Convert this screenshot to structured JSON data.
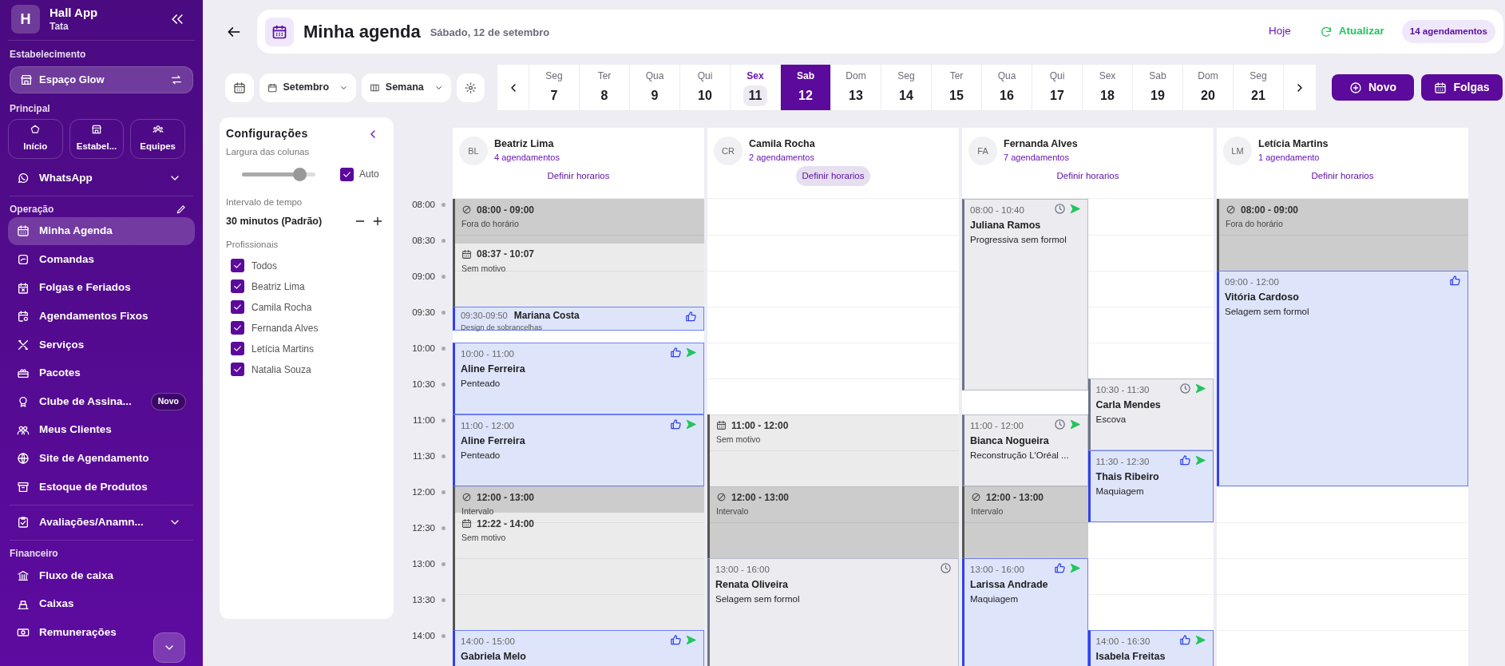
{
  "sidebar": {
    "logo_letter": "H",
    "app_name": "Hall App",
    "user": "Tata",
    "establishment_label": "Estabelecimento",
    "establishment": "Espaço Glow",
    "principal_label": "Principal",
    "tiles": [
      {
        "label": "Início"
      },
      {
        "label": "Estabel..."
      },
      {
        "label": "Equipes"
      }
    ],
    "groups": [
      {
        "items": [
          {
            "label": "WhatsApp",
            "kind": "expandable",
            "selected": false
          }
        ]
      },
      {
        "title": "Operação",
        "editable": true,
        "items": [
          {
            "label": "Minha Agenda",
            "kind": "link",
            "selected": true
          },
          {
            "label": "Comandas",
            "kind": "link",
            "selected": false
          },
          {
            "label": "Folgas e Feriados",
            "kind": "link",
            "selected": false
          },
          {
            "label": "Agendamentos Fixos",
            "kind": "link",
            "selected": false
          },
          {
            "label": "Serviços",
            "kind": "link",
            "selected": false
          },
          {
            "label": "Pacotes",
            "kind": "link",
            "selected": false
          },
          {
            "label": "Clube de Assina...",
            "kind": "link",
            "selected": false,
            "badge": "Novo"
          },
          {
            "label": "Meus Clientes",
            "kind": "link",
            "selected": false
          },
          {
            "label": "Site de Agendamento",
            "kind": "link",
            "selected": false
          },
          {
            "label": "Estoque de Produtos",
            "kind": "link",
            "selected": false
          }
        ]
      },
      {
        "items": [
          {
            "label": "Avaliações/Anamn...",
            "kind": "expandable",
            "selected": false
          }
        ]
      },
      {
        "title": "Financeiro",
        "editable": false,
        "items": [
          {
            "label": "Fluxo de caixa",
            "kind": "link",
            "selected": false
          },
          {
            "label": "Caixas",
            "kind": "link",
            "selected": false
          },
          {
            "label": "Remunerações",
            "kind": "link",
            "selected": false
          }
        ]
      }
    ]
  },
  "header": {
    "title": "Minha agenda",
    "date": "Sábado, 12 de setembro",
    "today_link": "Hoje",
    "refresh": "Atualizar",
    "count_badge": "14 agendamentos"
  },
  "toolbar": {
    "month": "Setembro",
    "view": "Semana"
  },
  "days": [
    {
      "day": "Seg",
      "date": "7",
      "selected": false,
      "today": false
    },
    {
      "day": "Ter",
      "date": "8",
      "selected": false,
      "today": false
    },
    {
      "day": "Qua",
      "date": "9",
      "selected": false,
      "today": false
    },
    {
      "day": "Qui",
      "date": "10",
      "selected": false,
      "today": false
    },
    {
      "day": "Sex",
      "date": "11",
      "selected": false,
      "today": true
    },
    {
      "day": "Sab",
      "date": "12",
      "selected": true,
      "today": false
    },
    {
      "day": "Dom",
      "date": "13",
      "selected": false,
      "today": false
    },
    {
      "day": "Seg",
      "date": "14",
      "selected": false,
      "today": false
    },
    {
      "day": "Ter",
      "date": "15",
      "selected": false,
      "today": false
    },
    {
      "day": "Qua",
      "date": "16",
      "selected": false,
      "today": false
    },
    {
      "day": "Qui",
      "date": "17",
      "selected": false,
      "today": false
    },
    {
      "day": "Sex",
      "date": "18",
      "selected": false,
      "today": false
    },
    {
      "day": "Sab",
      "date": "19",
      "selected": false,
      "today": false
    },
    {
      "day": "Dom",
      "date": "20",
      "selected": false,
      "today": false
    },
    {
      "day": "Seg",
      "date": "21",
      "selected": false,
      "today": false
    }
  ],
  "actions": [
    {
      "label": "Novo",
      "kind": "new"
    },
    {
      "label": "Folgas",
      "kind": "days_off"
    }
  ],
  "settings": {
    "title": "Configurações",
    "width_label": "Largura das colunas",
    "width_slider": {
      "level": 0.78
    },
    "auto": {
      "label": "Auto",
      "checked": true
    },
    "interval_label": "Intervalo de tempo",
    "interval_value": "30 minutos (Padrão)",
    "professionals_label": "Profissionais",
    "professionals": [
      {
        "label": "Todos",
        "checked": true
      },
      {
        "label": "Beatriz Lima",
        "checked": true
      },
      {
        "label": "Camila Rocha",
        "checked": true
      },
      {
        "label": "Fernanda Alves",
        "checked": true
      },
      {
        "label": "Letícia Martins",
        "checked": true
      },
      {
        "label": "Natalia Souza",
        "checked": true
      }
    ]
  },
  "time_labels": [
    "08:00",
    "08:30",
    "09:00",
    "09:30",
    "10:00",
    "10:30",
    "11:00",
    "11:30",
    "12:00",
    "12:30",
    "13:00",
    "13:30",
    "14:00"
  ],
  "columns": [
    {
      "initials": "BL",
      "name": "Beatriz Lima",
      "count": "4 agendamentos",
      "action": "Definir horarios",
      "hovered": false,
      "lanes": [
        {
          "events": [
            {
              "kind": "blocked",
              "time": "08:00 - 09:00",
              "note": "Fora do horário"
            },
            {
              "kind": "absence",
              "time": "08:37 - 10:07",
              "note": "Sem motivo"
            },
            {
              "kind": "appointment",
              "time": "09:30-09:50",
              "client": "Mariana Costa",
              "service": "Design de sobrancelhas",
              "confirmed": true,
              "sent": false
            },
            {
              "kind": "appointment",
              "time": "10:00 - 11:00",
              "client": "Aline Ferreira",
              "service": "Penteado",
              "confirmed": true,
              "sent": true
            },
            {
              "kind": "appointment",
              "time": "11:00 - 12:00",
              "client": "Aline Ferreira",
              "service": "Penteado",
              "confirmed": true,
              "sent": true
            },
            {
              "kind": "blocked",
              "time": "12:00 - 13:00",
              "note": "Intervalo"
            },
            {
              "kind": "absence",
              "time": "12:22 - 14:00",
              "note": "Sem motivo"
            },
            {
              "kind": "appointment",
              "time": "14:00 - 15:00",
              "client": "Gabriela Melo",
              "confirmed": true,
              "sent": true
            }
          ]
        }
      ]
    },
    {
      "initials": "CR",
      "name": "Camila Rocha",
      "count": "2 agendamentos",
      "action": "Definir horarios",
      "hovered": true,
      "lanes": [
        {
          "events": [
            {
              "kind": "absence",
              "time": "11:00 - 12:00",
              "note": "Sem motivo"
            },
            {
              "kind": "blocked",
              "time": "12:00 - 13:00",
              "note": "Intervalo"
            },
            {
              "kind": "appointment",
              "time": "13:00 - 16:00",
              "client": "Renata Oliveira",
              "service": "Selagem sem formol",
              "confirmed": false,
              "sent": false
            }
          ]
        }
      ]
    },
    {
      "initials": "FA",
      "name": "Fernanda Alves",
      "count": "7 agendamentos",
      "action": "Definir horarios",
      "hovered": false,
      "lanes": [
        {
          "events": [
            {
              "kind": "appointment",
              "time": "08:00 - 10:40",
              "client": "Juliana Ramos",
              "service": "Progressiva sem formol",
              "confirmed": false,
              "sent": true
            },
            {
              "kind": "appointment",
              "time": "11:00 - 12:00",
              "client": "Bianca Nogueira",
              "service": "Reconstrução L'Oréal ...",
              "confirmed": false,
              "sent": true
            },
            {
              "kind": "blocked",
              "time": "12:00 - 13:00",
              "note": "Intervalo"
            },
            {
              "kind": "appointment",
              "time": "13:00 - 16:00",
              "client": "Larissa Andrade",
              "service": "Maquiagem",
              "confirmed": true,
              "sent": true
            }
          ]
        },
        {
          "events": [
            {
              "kind": "appointment",
              "time": "10:30 - 11:30",
              "client": "Carla Mendes",
              "service": "Escova",
              "confirmed": false,
              "sent": true
            },
            {
              "kind": "appointment",
              "time": "11:30 - 12:30",
              "client": "Thais Ribeiro",
              "service": "Maquiagem",
              "confirmed": true,
              "sent": true
            },
            {
              "kind": "appointment",
              "time": "14:00 - 16:30",
              "client": "Isabela Freitas",
              "confirmed": true,
              "sent": true
            }
          ]
        }
      ]
    },
    {
      "initials": "LM",
      "name": "Letícia Martins",
      "count": "1 agendamento",
      "action": "Definir horarios",
      "hovered": false,
      "lanes": [
        {
          "events": [
            {
              "kind": "blocked",
              "time": "08:00 - 09:00",
              "note": "Fora do horário"
            },
            {
              "kind": "appointment",
              "time": "09:00 - 12:00",
              "client": "Vitória Cardoso",
              "service": "Selagem sem formol",
              "confirmed": true,
              "sent": false
            }
          ]
        }
      ]
    }
  ]
}
